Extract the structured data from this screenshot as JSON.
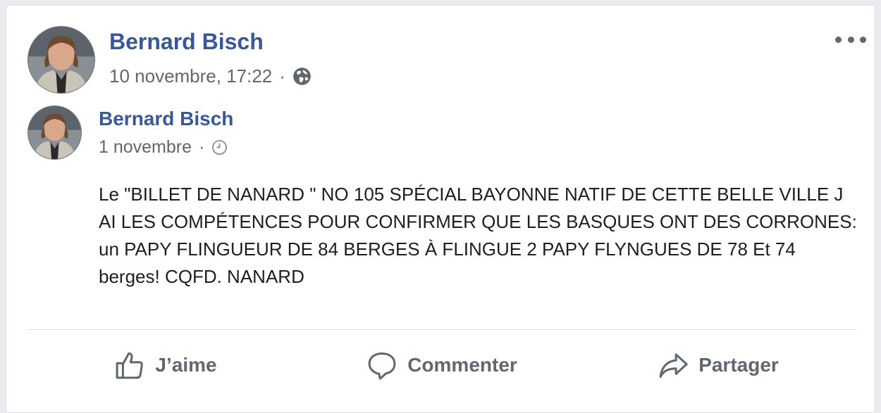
{
  "post": {
    "author": "Bernard Bisch",
    "timestamp": "10 novembre, 17:22",
    "separator": "·",
    "privacy_icon": "globe-icon",
    "menu_icon": "more-options-icon"
  },
  "shared_post": {
    "author": "Bernard Bisch",
    "timestamp": "1 novembre",
    "separator": "·",
    "time_icon": "clock-icon",
    "text": "Le \"BILLET DE NANARD \" NO 105 SPÉCIAL BAYONNE NATIF DE CETTE BELLE VILLE J AI LES COMPÉTENCES POUR CONFIRMER QUE LES BASQUES ONT DES CORRONES: un PAPY FLINGUEUR DE 84 BERGES À FLINGUE 2 PAPY FLYNGUES DE 78 Et 74 berges! CQFD. NANARD"
  },
  "actions": {
    "like_label": "J’aime",
    "comment_label": "Commenter",
    "share_label": "Partager"
  },
  "colors": {
    "author": "#385898",
    "meta": "#606770",
    "text": "#1c1e21",
    "background": "#e9ebee"
  }
}
